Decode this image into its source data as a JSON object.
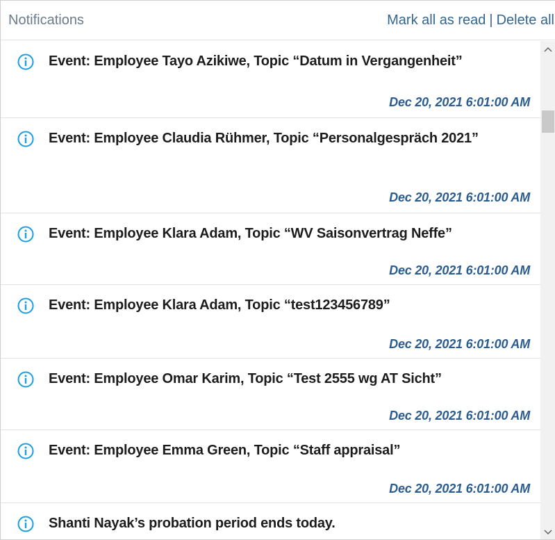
{
  "header": {
    "title": "Notifications",
    "mark_all_label": "Mark all as read",
    "separator": "|",
    "delete_all_label": "Delete all"
  },
  "colors": {
    "accent": "#33658f",
    "timestamp": "#2b5c8f",
    "info_icon": "#1a9ee0"
  },
  "notifications": [
    {
      "icon": "info-icon",
      "message": "Event: Employee Tayo Azikiwe, Topic “Datum in Vergangenheit”",
      "timestamp": "Dec 20, 2021 6:01:00 AM"
    },
    {
      "icon": "info-icon",
      "message": "Event: Employee Claudia Rühmer, Topic “Personalgespräch 2021”",
      "timestamp": "Dec 20, 2021 6:01:00 AM"
    },
    {
      "icon": "info-icon",
      "message": "Event: Employee Klara Adam, Topic “WV Saisonvertrag Neffe”",
      "timestamp": "Dec 20, 2021 6:01:00 AM"
    },
    {
      "icon": "info-icon",
      "message": "Event: Employee Klara Adam, Topic “test123456789”",
      "timestamp": "Dec 20, 2021 6:01:00 AM"
    },
    {
      "icon": "info-icon",
      "message": "Event: Employee Omar Karim, Topic “Test 2555 wg AT Sicht”",
      "timestamp": "Dec 20, 2021 6:01:00 AM"
    },
    {
      "icon": "info-icon",
      "message": "Event: Employee Emma Green, Topic “Staff appraisal”",
      "timestamp": "Dec 20, 2021 6:01:00 AM"
    },
    {
      "icon": "info-icon",
      "message": "Shanti Nayak’s probation period ends today.",
      "timestamp": ""
    }
  ],
  "scrollbar": {
    "up_icon": "chevron-up-icon",
    "down_icon": "chevron-down-icon"
  }
}
